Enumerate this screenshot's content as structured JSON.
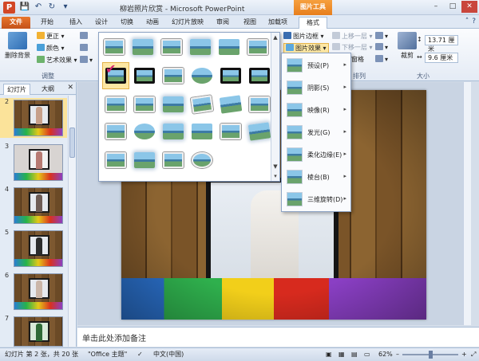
{
  "window": {
    "title": "柳岩照片欣赏 - Microsoft PowerPoint",
    "tools_tab": "图片工具",
    "app_icon_letter": "P",
    "qat_save": "💾",
    "qat_undo": "↶",
    "qat_redo": "↻",
    "qat_more": "▾",
    "ctl_min": "–",
    "ctl_max": "□",
    "ctl_close": "✕"
  },
  "tabs": [
    "文件",
    "开始",
    "插入",
    "设计",
    "切换",
    "动画",
    "幻灯片放映",
    "审阅",
    "视图",
    "加载项",
    "格式"
  ],
  "ribbon": {
    "remove_bg": "删除背景",
    "corrections": "更正",
    "color": "颜色",
    "artistic": "艺术效果",
    "adjust_group": "调整",
    "border": "图片边框",
    "effects": "图片效果",
    "bring_forward": "上移一层",
    "send_backward": "下移一层",
    "selection_pane": "窗格",
    "arrange_group": "排列",
    "crop": "裁剪",
    "height": "13.71 厘米",
    "width": "9.6 厘米",
    "size_group": "大小"
  },
  "leftpanel": {
    "tab_slides": "幻灯片",
    "tab_outline": "大纲",
    "close": "✕",
    "slide_numbers": [
      "2",
      "3",
      "4",
      "5",
      "6",
      "7"
    ]
  },
  "notes": {
    "placeholder": "单击此处添加备注"
  },
  "statusbar": {
    "slide_info": "幻灯片 第 2 张，共 20 张",
    "theme": "\"Office 主题\"",
    "language": "中文(中国)",
    "zoom": "62%",
    "zoom_minus": "–",
    "zoom_plus": "+"
  },
  "effects_menu": {
    "items": [
      "预设(P)",
      "阴影(S)",
      "映像(R)",
      "发光(G)",
      "柔化边缘(E)",
      "棱台(B)",
      "三维旋转(D)"
    ],
    "arrow": "▸"
  },
  "gallery": {
    "check": "✔",
    "scroll_up": "▲",
    "scroll_down": "▼",
    "scroll_more": "▾"
  }
}
